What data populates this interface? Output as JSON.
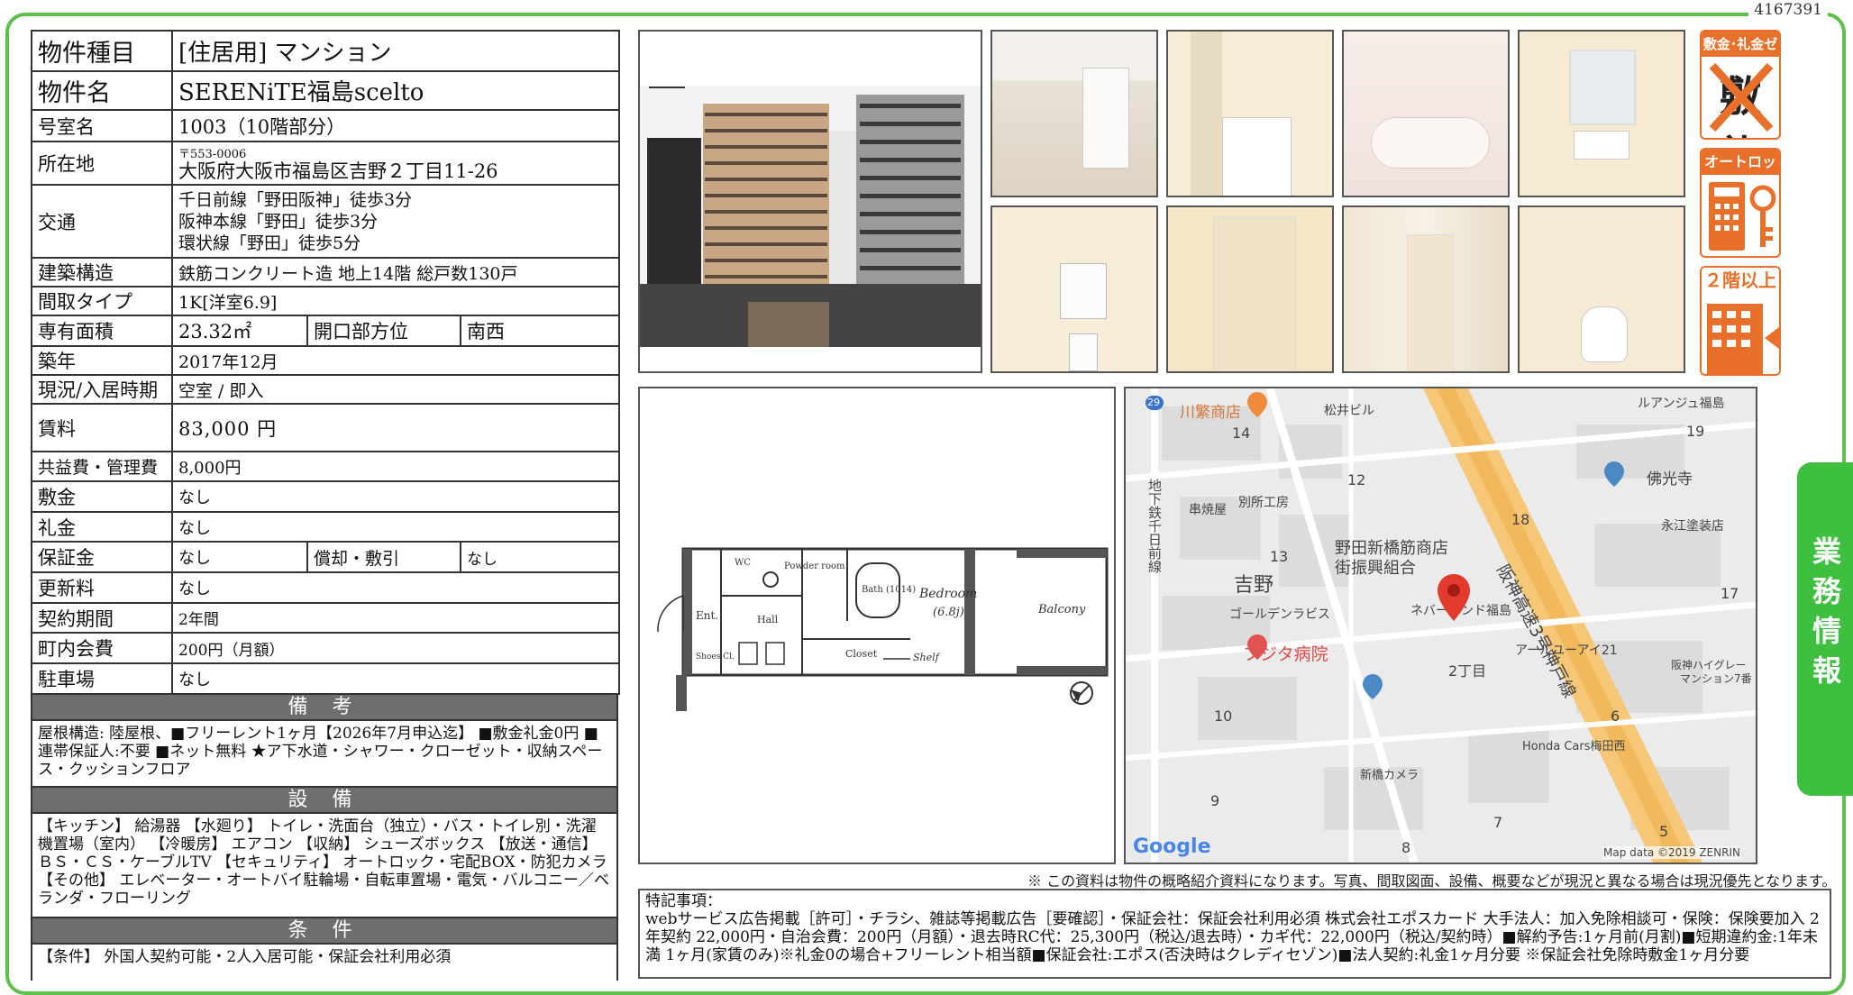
{
  "property_id": "4167391",
  "rows": {
    "type": {
      "label": "物件種目",
      "value": "[住居用] マンション"
    },
    "name": {
      "label": "物件名",
      "value": "SERENiTE福島scelto"
    },
    "room": {
      "label": "号室名",
      "value": "1003（10階部分）"
    },
    "address": {
      "label": "所在地",
      "zip": "〒553-0006",
      "value": "大阪府大阪市福島区吉野２丁目11-26"
    },
    "transport": {
      "label": "交通",
      "lines": [
        "千日前線「野田阪神」徒歩3分",
        "阪神本線「野田」徒歩3分",
        "環状線「野田」徒歩5分"
      ]
    },
    "structure": {
      "label": "建築構造",
      "value": "鉄筋コンクリート造 地上14階 総戸数130戸"
    },
    "layout": {
      "label": "間取タイプ",
      "value": "1K[洋室6.9]"
    },
    "area": {
      "label": "専有面積",
      "value": "23.32㎡",
      "sub_label": "開口部方位",
      "sub_value": "南西"
    },
    "built": {
      "label": "築年",
      "value": "2017年12月"
    },
    "status": {
      "label": "現況/入居時期",
      "value": "空室 / 即入"
    },
    "rent": {
      "label": "賃料",
      "value": "83,000 円"
    },
    "fee": {
      "label": "共益費・管理費",
      "value": "8,000円"
    },
    "deposit": {
      "label": "敷金",
      "value": "なし"
    },
    "key_money": {
      "label": "礼金",
      "value": "なし"
    },
    "guarantee": {
      "label": "保証金",
      "value": "なし",
      "sub_label": "償却・敷引",
      "sub_value": "なし"
    },
    "renewal": {
      "label": "更新料",
      "value": "なし"
    },
    "contract": {
      "label": "契約期間",
      "value": "2年間"
    },
    "town_fee": {
      "label": "町内会費",
      "value": "200円（月額）"
    },
    "parking": {
      "label": "駐車場",
      "value": "なし"
    }
  },
  "sections": {
    "remarks": {
      "title": "備 考",
      "text": "屋根構造: 陸屋根、■フリーレント1ヶ月【2026年7月申込迄】 ■敷金礼金0円 ■連帯保証人:不要 ■ネット無料 ★ア下水道・シャワー・クローゼット・収納スペース・クッションフロア"
    },
    "equipment": {
      "title": "設 備",
      "text": "【キッチン】 給湯器 【水廻り】 トイレ・洗面台（独立）・バス・トイレ別・洗濯機置場（室内） 【冷暖房】 エアコン 【収納】 シューズボックス 【放送・通信】 ＢＳ・ＣＳ・ケーブルTV 【セキュリティ】 オートロック・宅配BOX・防犯カメラ 【その他】 エレベーター・オートバイ駐輪場・自転車置場・電気・バルコニー／ベランダ・フローリング"
    },
    "conditions": {
      "title": "条 件",
      "text": "【条件】 外国人契約可能・2人入居可能・保証会社利用必須"
    }
  },
  "badges": {
    "zero": {
      "head": "敷金･礼金ゼロ",
      "body": "敷礼"
    },
    "autolock": {
      "head": "オートロック"
    },
    "floor": {
      "head": "２階以上"
    }
  },
  "floor_plan": {
    "bedroom": "Bedroom",
    "bedroom_size": "(6.8j)",
    "balcony": "Balcony",
    "hall": "Hall",
    "ent": "Ent.",
    "powder": "Powder room",
    "bath": "Bath (1014)",
    "closet": "Closet",
    "shelf": "Shelf",
    "shoes": "Shoes Cl.",
    "wc": "WC"
  },
  "map": {
    "labels": [
      "川繁商店",
      "松井ビル",
      "ルアンジュ福島",
      "14",
      "19",
      "12",
      "佛光寺",
      "永江塗装店",
      "串焼屋",
      "別所工房",
      "野田新橋筋商店",
      "街振興組合",
      "18",
      "地下鉄千日前線",
      "阪神高速3号神戸線",
      "13",
      "吉野",
      "ゴールデンラビス",
      "ネバーランド福島",
      "17",
      "フジタ病院",
      "アールユーアイ21",
      "2丁目",
      "阪神ハイグレー",
      "マンション7番",
      "10",
      "6",
      "Honda Cars梅田西",
      "新橋カメラ",
      "9",
      "7",
      "5",
      "8"
    ],
    "route": "29",
    "google": "Google",
    "copyright": "Map data ©2019 ZENRIN"
  },
  "note": "※ この資料は物件の概略紹介資料になります。写真、間取図面、設備、概要などが現況と異なる場合は現況優先となります。",
  "special": {
    "title": "特記事項：",
    "text": "webサービス広告掲載［許可］・チラシ、雑誌等掲載広告［要確認］・保証会社：保証会社利用必須 株式会社エポスカード 大手法人：加入免除相談可・保険：保険要加入 2年契約 22,000円・自治会費：200円（月額）・退去時RC代：25,300円（税込/退去時）・カギ代：22,000円（税込/契約時）■解約予告:1ヶ月前(月割)■短期違約金:1年未満 1ヶ月(家賃のみ)※礼金0の場合+フリーレント相当額■保証会社:エポス(否決時はクレディセゾン)■法人契約:礼金1ヶ月分要 ※保証会社免除時敷金1ヶ月分要"
  },
  "side_tab": "業務情報",
  "colors": {
    "accent_green": "#3fbf3f",
    "badge_orange": "#e8702a",
    "section_gray": "#6e6e6e"
  }
}
